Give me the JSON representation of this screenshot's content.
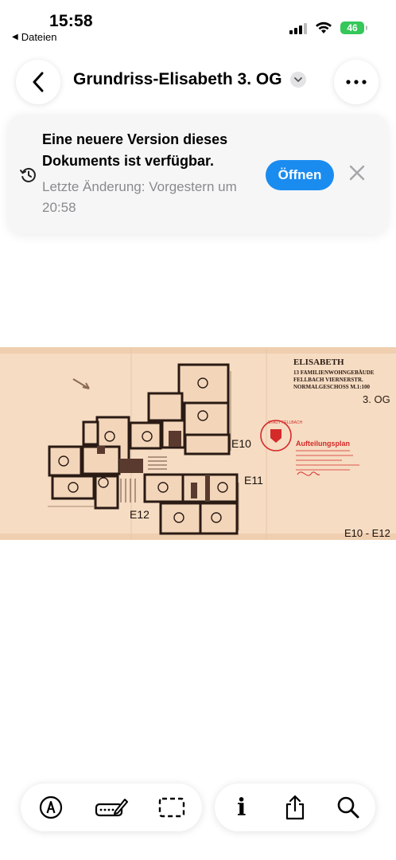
{
  "status_bar": {
    "time": "15:58",
    "back_app": "Dateien",
    "back_arrow": "◀",
    "battery_level": "46",
    "icons": [
      "signal-icon",
      "wifi-icon",
      "battery-icon"
    ]
  },
  "nav": {
    "title": "Grundriss-Elisabeth 3. OG",
    "icons": [
      "chevron-left-icon",
      "chevron-down-icon",
      "more-icon"
    ]
  },
  "banner": {
    "heading": "Eine neuere Version dieses Dokuments ist verfügbar.",
    "subtitle": "Letzte Änderung: Vorgestern um 20:58",
    "open_label": "Öffnen",
    "icons": [
      "history-icon",
      "close-icon"
    ],
    "accent_color": "#1a8cf0"
  },
  "document": {
    "header_line1": "ELISABETH",
    "header_line2": "13 FAMILIENWOHNGEBÄUDE",
    "header_line3": "FELLBACH VIERNERSTR.",
    "header_line4": "NORMALGESCHOSS M.1:100",
    "floor_label": "3. OG",
    "unit_e10": "E10",
    "unit_e11": "E11",
    "unit_e12": "E12",
    "unit_range": "E10 - E12",
    "stamp_text": "STADT FELLBACH",
    "stamp_label": "Aufteilungsplan"
  },
  "toolbar": {
    "info_label": "i",
    "icons": [
      "markup-icon",
      "signature-icon",
      "selection-icon",
      "info-icon",
      "share-icon",
      "search-icon"
    ]
  }
}
